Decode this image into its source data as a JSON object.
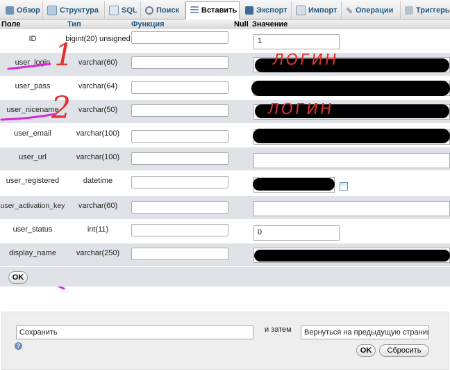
{
  "tabs": [
    {
      "label": "Обзор",
      "icon": "browse-icon"
    },
    {
      "label": "Структура",
      "icon": "structure-icon"
    },
    {
      "label": "SQL",
      "icon": "sql-icon"
    },
    {
      "label": "Поиск",
      "icon": "search-icon"
    },
    {
      "label": "Вставить",
      "icon": "insert-icon",
      "active": true
    },
    {
      "label": "Экспорт",
      "icon": "export-icon"
    },
    {
      "label": "Импорт",
      "icon": "import-icon"
    },
    {
      "label": "Операции",
      "icon": "operations-icon"
    },
    {
      "label": "Триггеры",
      "icon": "triggers-icon"
    }
  ],
  "header": {
    "field": "Поле",
    "type": "Тип",
    "function": "Функция",
    "null": "Null",
    "value": "Значение"
  },
  "rows": [
    {
      "name": "ID",
      "type": "bigint(20) unsigned",
      "value": "1"
    },
    {
      "name": "user_login",
      "type": "varchar(60)",
      "value": ""
    },
    {
      "name": "user_pass",
      "type": "varchar(64)",
      "value": ""
    },
    {
      "name": "user_nicename",
      "type": "varchar(50)",
      "value": ""
    },
    {
      "name": "user_email",
      "type": "varchar(100)",
      "value": ""
    },
    {
      "name": "user_url",
      "type": "varchar(100)",
      "value": ""
    },
    {
      "name": "user_registered",
      "type": "datetime",
      "value": ""
    },
    {
      "name": "user_activation_key",
      "type": "varchar(60)",
      "value": ""
    },
    {
      "name": "user_status",
      "type": "int(11)",
      "value": "0"
    },
    {
      "name": "display_name",
      "type": "varchar(250)",
      "value": ""
    }
  ],
  "annotations": {
    "num1": "1",
    "num2": "2",
    "login1": "ЛОГИН",
    "login2": "ЛОГИН",
    "color": "#e03030",
    "underline_color": "#d62ad6"
  },
  "ok_label": "OK",
  "form": {
    "action_value": "Сохранить",
    "then_label": "и затем",
    "after_value": "Вернуться на предыдущую страницу",
    "ok_label": "OK",
    "reset_label": "Сбросить"
  },
  "colors": {
    "tab_text": "#235a81",
    "row_alt": "#dfe3e8"
  }
}
